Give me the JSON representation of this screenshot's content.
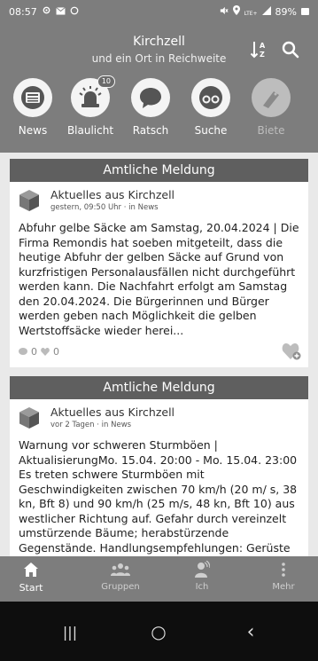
{
  "status_bar": {
    "time": "08:57",
    "left_icons": [
      "settings-icon",
      "mail-icon",
      "sync-icon"
    ],
    "right_icons": [
      "mute-icon",
      "location-icon",
      "wifi-icon",
      "signal-icon"
    ],
    "network_label": "LTE+",
    "battery": "89%"
  },
  "header": {
    "title": "Kirchzell",
    "subtitle": "und ein Ort in Reichweite",
    "sort_icon": "sort-az-icon",
    "search_icon": "search-icon"
  },
  "categories": [
    {
      "label": "News",
      "icon": "newspaper-icon"
    },
    {
      "label": "Blaulicht",
      "icon": "siren-icon",
      "badge": "10"
    },
    {
      "label": "Ratsch",
      "icon": "chat-bubble-icon"
    },
    {
      "label": "Suche",
      "icon": "binoculars-icon"
    },
    {
      "label": "Biete",
      "icon": "tag-icon"
    }
  ],
  "posts": [
    {
      "category": "Amtliche Meldung",
      "source": "Aktuelles aus Kirchzell",
      "meta": "gestern, 09:50 Uhr · in News",
      "text": "Abfuhr gelbe Säcke am Samstag, 20.04.2024 | Die Firma Remondis hat soeben mitgeteilt, dass die heutige Abfuhr der gelben Säcke auf Grund von kurzfristigen Personalausfällen nicht durchgeführt werden kann. Die Nachfahrt erfolgt am Samstag den 20.04.2024. Die Bürgerinnen und Bürger werden geben nach Möglichkeit die gelben Wertstoffsäcke wieder herei...",
      "comments": "0",
      "likes": "0"
    },
    {
      "category": "Amtliche Meldung",
      "source": "Aktuelles aus Kirchzell",
      "meta": "vor 2 Tagen · in News",
      "text": "Warnung vor schweren Sturmböen | AktualisierungMo. 15.04. 20:00 - Mo. 15.04. 23:00 Es treten schwere Sturmböen mit Geschwindigkeiten zwischen 70 km/h (20 m/ s, 38 kn, Bft 8) und 90 km/h (25 m/s, 48 kn, Bft 10) aus westlicher Richtung auf. Gefahr durch vereinzelt umstürzende Bäume; herabstürzende Gegenstände. Handlungsempfehlungen: Gerüste"
    }
  ],
  "bottom_nav": [
    {
      "label": "Start",
      "icon": "home-icon",
      "active": true
    },
    {
      "label": "Gruppen",
      "icon": "groups-icon"
    },
    {
      "label": "Ich",
      "icon": "profile-icon"
    },
    {
      "label": "Mehr",
      "icon": "more-vertical-icon"
    }
  ],
  "system_nav": {
    "recents": "|||",
    "home": "○",
    "back": "‹"
  },
  "colors": {
    "header_bg": "#7d7d7d",
    "card_header_bg": "#5f5f5f",
    "feed_bg": "#e9e9e9",
    "system_nav_bg": "#0e0e0e"
  }
}
